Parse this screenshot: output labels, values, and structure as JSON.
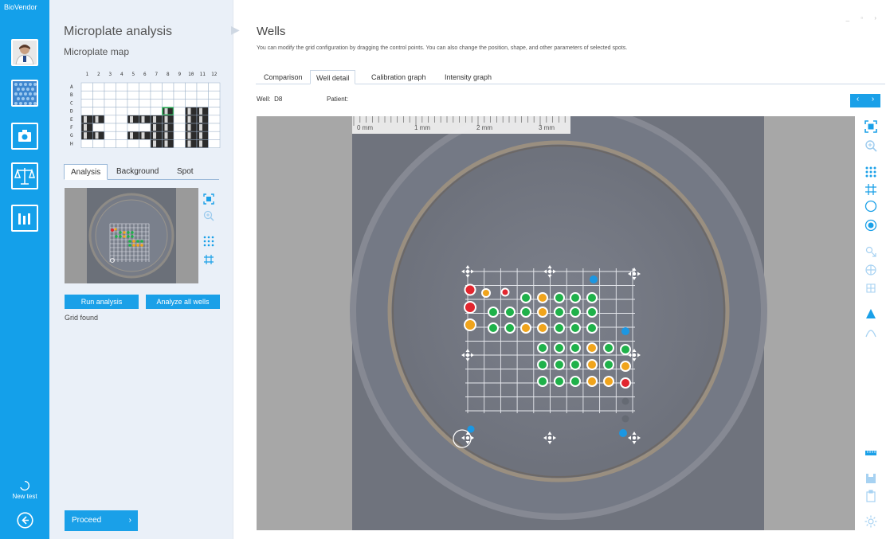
{
  "app": {
    "brand": "BioVendor"
  },
  "rail": {
    "items": [
      {
        "name": "user-photo",
        "icon": "user-photo-icon"
      },
      {
        "name": "microplate",
        "icon": "microplate-icon"
      },
      {
        "name": "camera",
        "icon": "camera-icon"
      },
      {
        "name": "analysis",
        "icon": "balance-scale-icon"
      },
      {
        "name": "results",
        "icon": "bar-chart-icon"
      }
    ],
    "new_test_label": "New test"
  },
  "panel": {
    "title": "Microplate analysis",
    "subtitle": "Microplate map",
    "plate": {
      "columns": [
        "1",
        "2",
        "3",
        "4",
        "5",
        "6",
        "7",
        "8",
        "9",
        "10",
        "11",
        "12"
      ],
      "rows": [
        "A",
        "B",
        "C",
        "D",
        "E",
        "F",
        "G",
        "H"
      ],
      "selected_well": "D8"
    },
    "tabs": [
      {
        "label": "Analysis",
        "active": true
      },
      {
        "label": "Background",
        "active": false
      },
      {
        "label": "Spot",
        "active": false
      }
    ],
    "run_analysis_label": "Run analysis",
    "analyze_all_label": "Analyze all wells",
    "status": "Grid found",
    "proceed_label": "Proceed",
    "proceed_arrow": "›"
  },
  "main": {
    "title": "Wells",
    "description": "You can modify the grid configuration by dragging the control points. You can also change the position, shape, and other parameters of selected spots.",
    "tabs": [
      {
        "label": "Comparison",
        "active": false
      },
      {
        "label": "Well detail",
        "active": true
      },
      {
        "label": "Calibration graph",
        "active": false
      },
      {
        "label": "Intensity graph",
        "active": false
      }
    ],
    "well_label": "Well:",
    "well_value": "D8",
    "patient_label": "Patient:",
    "patient_value": "",
    "nav_prev": "‹",
    "nav_next": "›",
    "ruler_labels": [
      "0 mm",
      "1 mm",
      "2 mm",
      "3 mm"
    ],
    "window_controls": "_ ▫ ›"
  },
  "colors": {
    "accent": "#1aa0e8",
    "spot_green": "#1fb14a",
    "spot_orange": "#f0a41c",
    "spot_red": "#e2262f",
    "spot_blue": "#1c97e2"
  }
}
